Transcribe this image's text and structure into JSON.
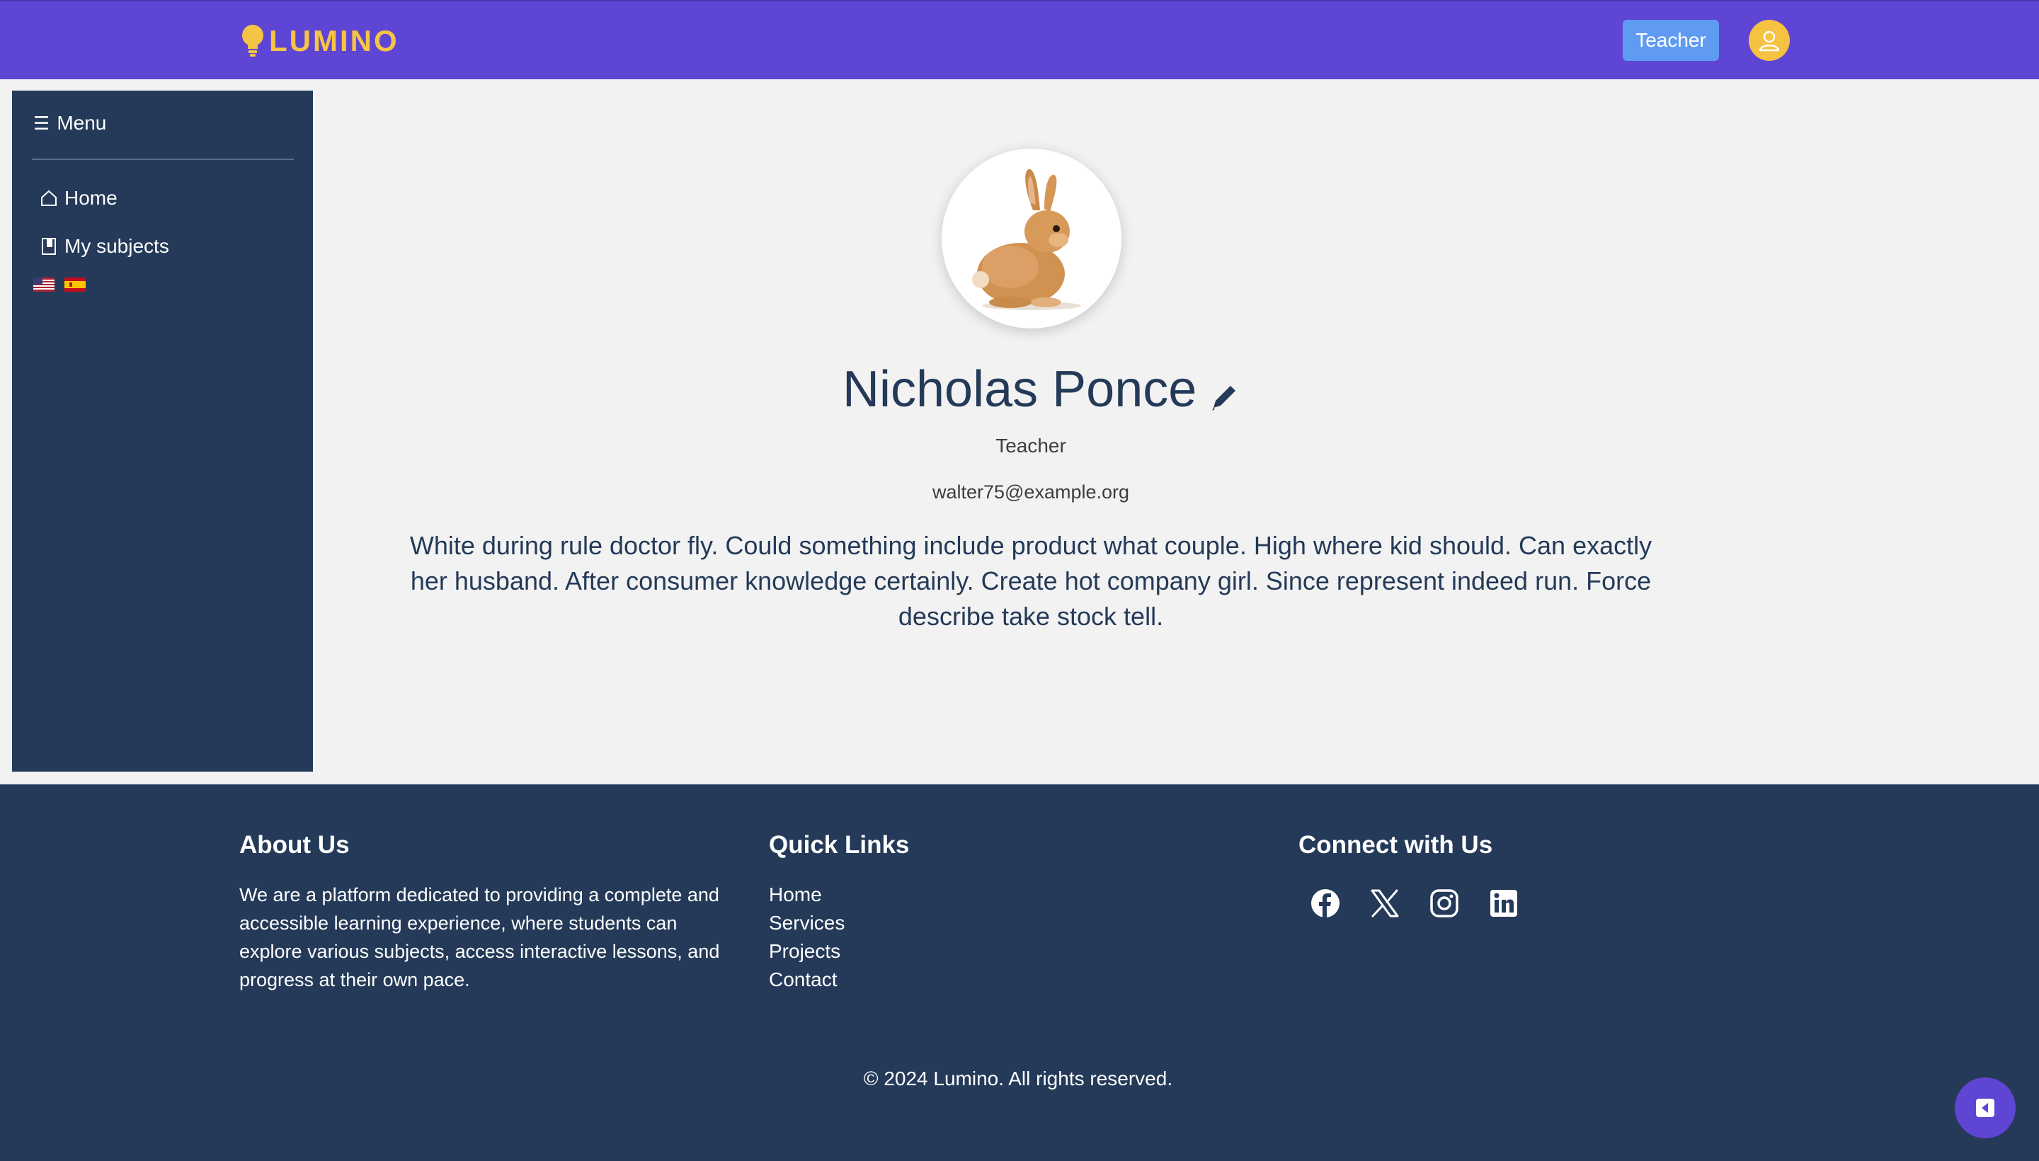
{
  "header": {
    "logo_text": "LUMINO",
    "role_button": "Teacher",
    "brand_color": "#5f45d3",
    "accent_color": "#f6c445"
  },
  "sidebar": {
    "menu_label": "Menu",
    "items": [
      {
        "label": "Home",
        "icon": "home-icon"
      },
      {
        "label": "My subjects",
        "icon": "book-icon"
      }
    ],
    "languages": [
      "us-flag-icon",
      "es-flag-icon"
    ]
  },
  "profile": {
    "name": "Nicholas Ponce",
    "role": "Teacher",
    "email": "walter75@example.org",
    "bio": "White during rule doctor fly. Could something include product what couple. High where kid should. Can exactly her husband. After consumer knowledge certainly. Create hot company girl. Since represent indeed run. Force describe take stock tell.",
    "avatar": "rabbit-image"
  },
  "footer": {
    "about_title": "About Us",
    "about_text": "We are a platform dedicated to providing a complete and accessible learning experience, where students can explore various subjects, access interactive lessons, and progress at their own pace.",
    "links_title": "Quick Links",
    "links": [
      "Home",
      "Services",
      "Projects",
      "Contact"
    ],
    "social_title": "Connect with Us",
    "social": [
      "facebook-icon",
      "x-icon",
      "instagram-icon",
      "linkedin-icon"
    ],
    "copyright": "© 2024 Lumino. All rights reserved."
  }
}
